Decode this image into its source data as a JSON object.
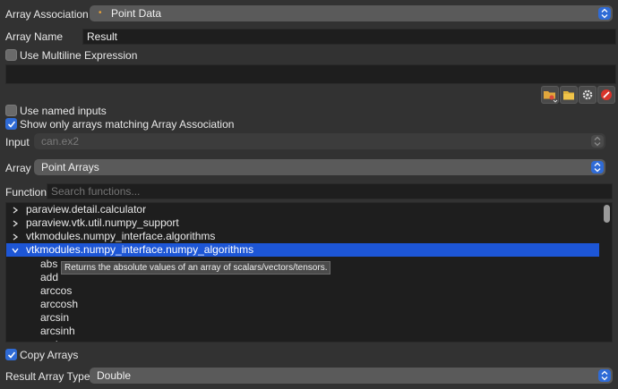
{
  "array_association": {
    "label": "Array Association",
    "value": "Point Data",
    "bullet": "•"
  },
  "array_name": {
    "label": "Array Name",
    "value": "Result"
  },
  "multiline": {
    "label": "Use Multiline Expression",
    "checked": false
  },
  "expression": {
    "value": ""
  },
  "toolbar": {
    "icons": [
      "folder-open-icon",
      "folder-icon",
      "gear-icon",
      "cancel-icon"
    ]
  },
  "named_inputs": {
    "label": "Use named inputs",
    "checked": false
  },
  "show_only": {
    "label": "Show only arrays matching Array Association",
    "checked": true
  },
  "input": {
    "label": "Input",
    "value": "can.ex2"
  },
  "array": {
    "label": "Array",
    "value": "Point Arrays"
  },
  "function": {
    "label": "Function",
    "placeholder": "Search functions..."
  },
  "tree": {
    "groups": [
      {
        "label": "paraview.detail.calculator",
        "expanded": false
      },
      {
        "label": "paraview.vtk.util.numpy_support",
        "expanded": false
      },
      {
        "label": "vtkmodules.numpy_interface.algorithms",
        "expanded": false
      },
      {
        "label": "vtkmodules.numpy_interface.numpy_algorithms",
        "expanded": true
      }
    ],
    "children": [
      "abs",
      "add",
      "arccos",
      "arccosh",
      "arcsin",
      "arcsinh",
      "arctan"
    ]
  },
  "tooltip": {
    "text": "Returns the absolute values of an array of scalars/vectors/tensors."
  },
  "copy_arrays": {
    "label": "Copy Arrays",
    "checked": true
  },
  "result_type": {
    "label": "Result Array Type",
    "value": "Double"
  },
  "colors": {
    "background": "#323232",
    "accent": "#2f6bd6",
    "selection": "#1d56d6",
    "field": "#1e1e1e"
  }
}
